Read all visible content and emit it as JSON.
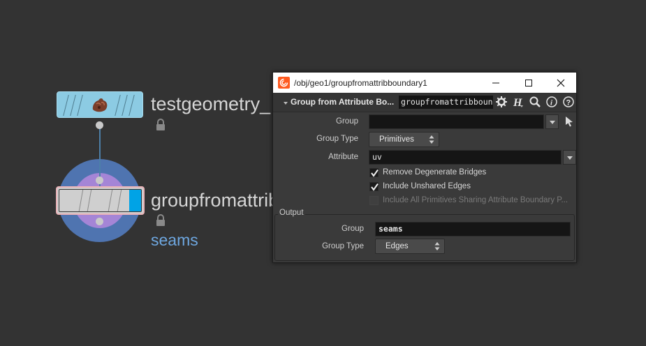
{
  "network": {
    "node1": {
      "name": "testgeometry_"
    },
    "node2": {
      "name": "groupfromattrib",
      "group_label": "seams"
    }
  },
  "window": {
    "title": "/obj/geo1/groupfromattribboundary1",
    "operator_type": "Group from Attribute Bo...",
    "node_name_field": "groupfromattribboun",
    "controls": {
      "minimize": "—",
      "maximize": "☐",
      "close": "✕"
    }
  },
  "params": {
    "group": {
      "label": "Group",
      "value": ""
    },
    "group_type": {
      "label": "Group Type",
      "value": "Primitives"
    },
    "attribute": {
      "label": "Attribute",
      "value": "uv"
    },
    "remove_degenerate": {
      "label": "Remove Degenerate Bridges",
      "checked": true
    },
    "include_unshared": {
      "label": "Include Unshared Edges",
      "checked": true
    },
    "include_all_prims": {
      "label": "Include All Primitives Sharing Attribute Boundary P...",
      "checked": false,
      "disabled": true
    }
  },
  "output": {
    "title": "Output",
    "group": {
      "label": "Group",
      "value": "seams"
    },
    "group_type": {
      "label": "Group Type",
      "value": "Edges"
    }
  },
  "icons": [
    "geometry-icon",
    "lock-icon",
    "houdini-icon",
    "gear-icon",
    "help-h-icon",
    "search-icon",
    "info-icon",
    "question-icon",
    "pointer-icon"
  ],
  "colors": {
    "background": "#333333",
    "node1": "#8ccbe3",
    "node2_flag": "#00a3e6",
    "ring_outer": "#4f74b0",
    "ring_inner": "#a585d6",
    "group_label": "#6ea7e0"
  }
}
